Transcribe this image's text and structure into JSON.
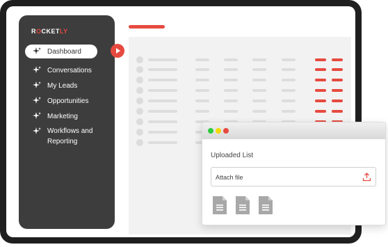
{
  "brand": {
    "logo_prefix": "R",
    "logo_o": "O",
    "logo_mid": "CKET",
    "logo_suffix": "LY",
    "accent": "#e64a3f"
  },
  "sidebar": {
    "items": [
      {
        "label": "Dashboard",
        "active": true
      },
      {
        "label": "Conversations"
      },
      {
        "label": "My Leads"
      },
      {
        "label": "Opportunities"
      },
      {
        "label": "Marketing"
      },
      {
        "label_line1": "Workflows and",
        "label_line2": "Reporting"
      }
    ]
  },
  "popup": {
    "title": "Uploaded List",
    "attach_label": "Attach file",
    "traffic_lights": [
      "#2ecc40",
      "#f5d90a",
      "#e64a3f"
    ]
  },
  "icons": {
    "nav": "sparkle-icon",
    "play": "play-icon",
    "upload": "upload-icon",
    "file": "document-icon"
  }
}
